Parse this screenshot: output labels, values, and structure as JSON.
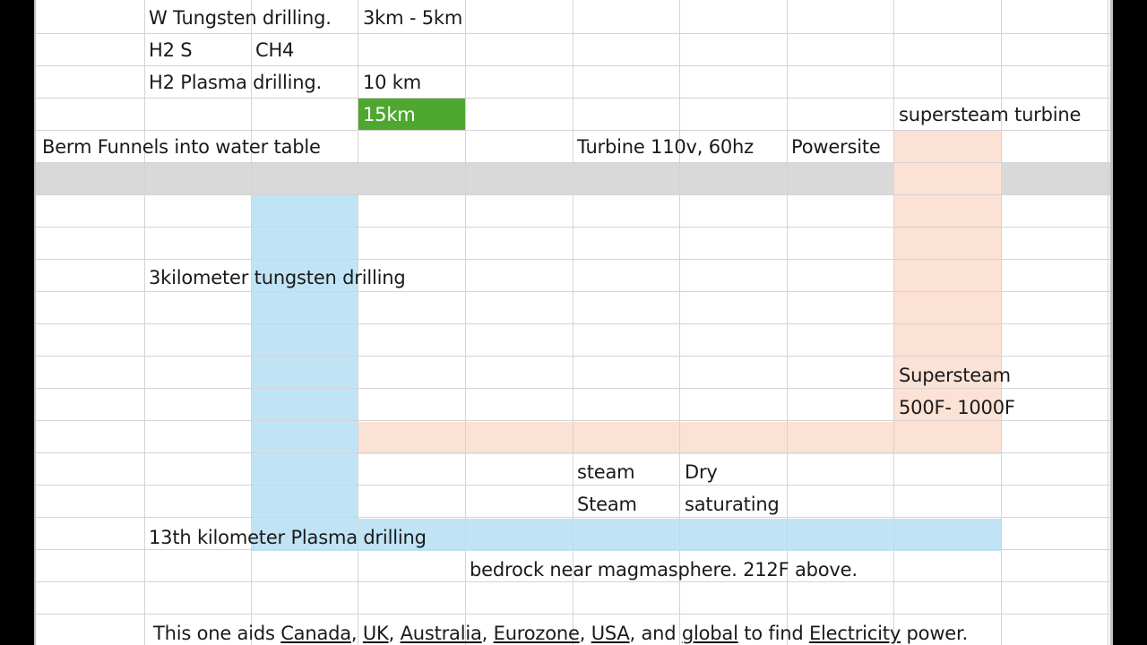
{
  "sheet": {
    "fills": {
      "green": "#4ea72e",
      "gray": "#d9d9d9",
      "blue": "#c0e4f5",
      "peach": "#fbe2d5"
    },
    "cells": {
      "w_tungsten": "W Tungsten drilling.",
      "range_3_5": "3km - 5km",
      "h2s": "H2 S",
      "ch4": "CH4",
      "h2_plasma": "H2 Plasma drilling.",
      "km10": "10 km",
      "km15": "15km",
      "supersteam_turbine": "supersteam turbine",
      "berm": "Berm Funnels into water table",
      "turbine": "Turbine 110v, 60hz",
      "powersite": "Powersite",
      "tungsten_3km": "3kilometer tungsten drilling",
      "supersteam": "Supersteam",
      "temp_range": "500F- 1000F",
      "steam_lower": "steam",
      "dry": "Dry",
      "steam_upper": "Steam",
      "saturating": "saturating",
      "plasma_13": "13th kilometer Plasma drilling",
      "bedrock": "bedrock near magmasphere. 212F above."
    },
    "footer": {
      "text_a": "This one aids ",
      "canada": "Canada",
      "sep1": ", ",
      "uk": "UK",
      "sep2": ", ",
      "australia": "Australia",
      "sep3": ", ",
      "eurozone": "Eurozone",
      "sep4": ", ",
      "usa": "USA",
      "sep5": ", and ",
      "global": "global",
      "text_b": " to find ",
      "electricity": "Electricity",
      "text_c": " power."
    }
  }
}
